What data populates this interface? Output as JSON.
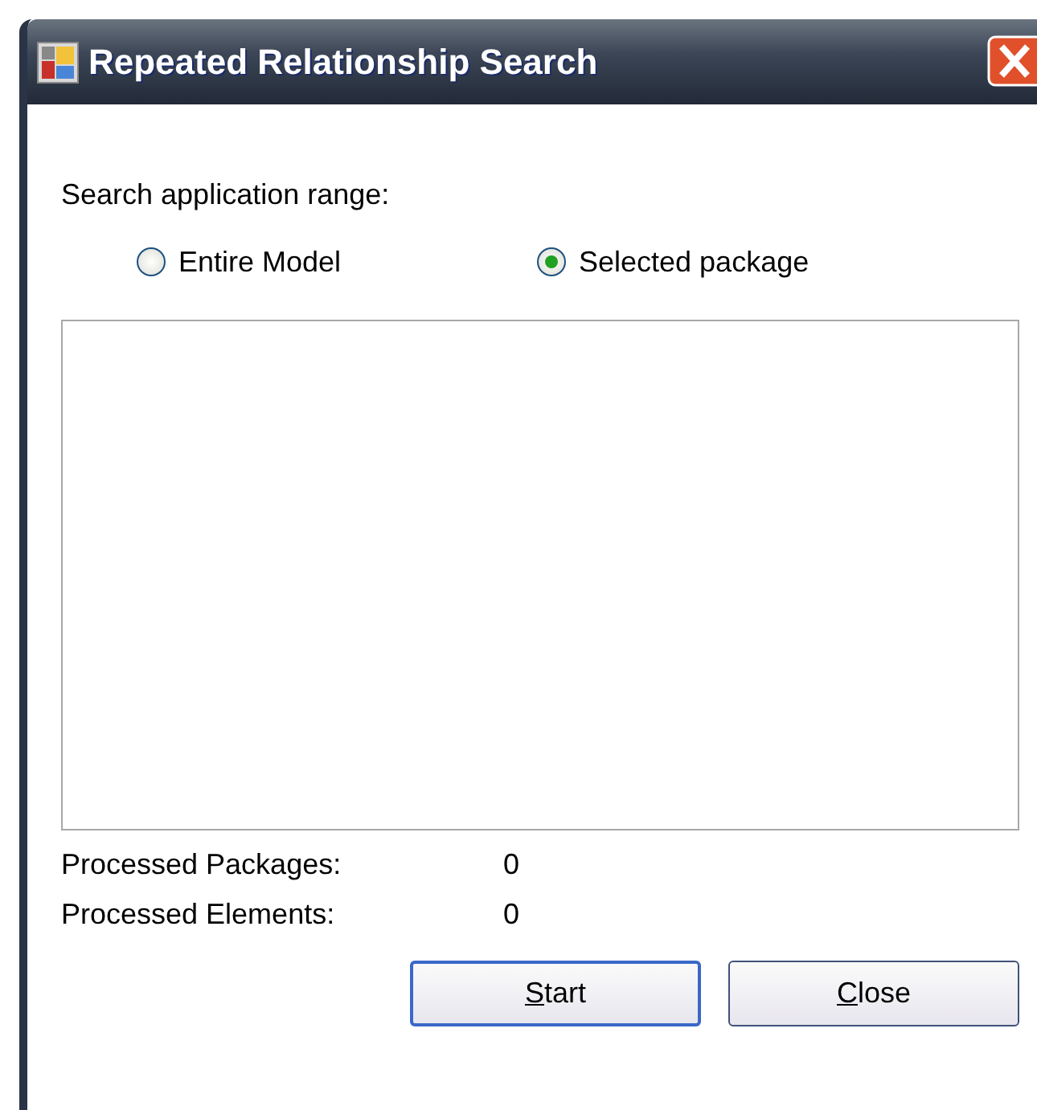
{
  "window": {
    "title": "Repeated Relationship Search"
  },
  "range": {
    "label": "Search application range:",
    "options": [
      {
        "label": "Entire Model",
        "selected": false
      },
      {
        "label": "Selected package",
        "selected": true
      }
    ]
  },
  "stats": [
    {
      "label": "Processed Packages:",
      "value": "0"
    },
    {
      "label": "Processed Elements:",
      "value": "0"
    }
  ],
  "buttons": [
    {
      "label": "Start",
      "underline_first_letter": true,
      "default": true
    },
    {
      "label": "Close",
      "underline_first_letter": true,
      "default": false
    }
  ]
}
